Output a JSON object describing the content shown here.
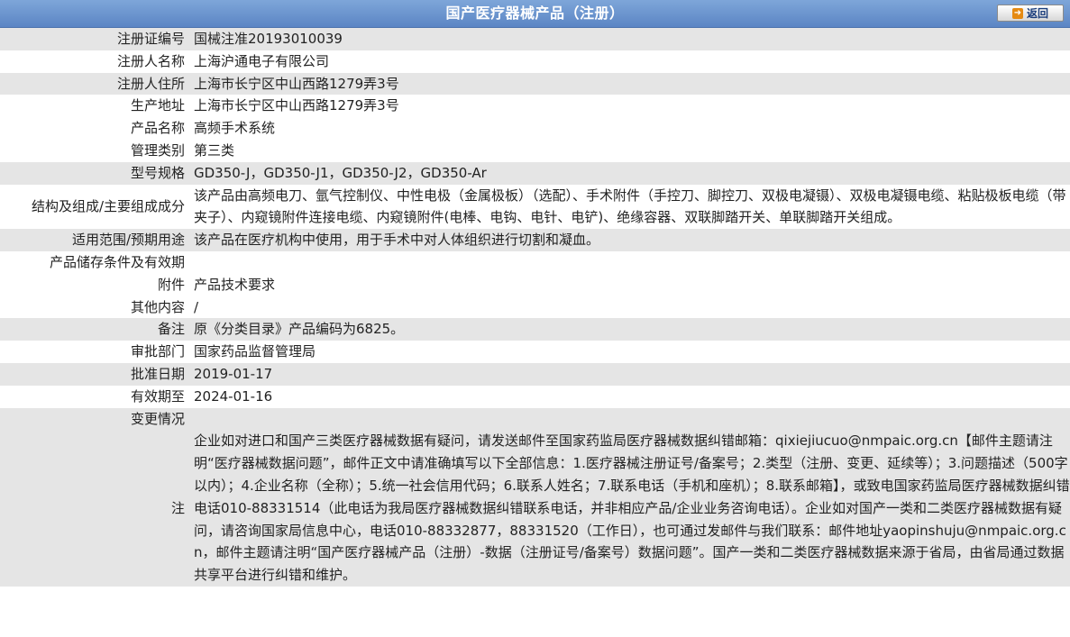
{
  "header": {
    "title": "国产医疗器械产品（注册）",
    "back_label": "返回"
  },
  "rows": [
    {
      "label": "注册证编号",
      "value": "国械注准20193010039"
    },
    {
      "label": "注册人名称",
      "value": "上海沪通电子有限公司"
    },
    {
      "label": "注册人住所",
      "value": "上海市长宁区中山西路1279弄3号"
    },
    {
      "label": "生产地址",
      "value": "上海市长宁区中山西路1279弄3号"
    },
    {
      "label": "产品名称",
      "value": "高频手术系统"
    },
    {
      "label": "管理类别",
      "value": "第三类"
    },
    {
      "label": "型号规格",
      "value": "GD350-J，GD350-J1，GD350-J2，GD350-Ar"
    },
    {
      "label": "结构及组成/主要组成成分",
      "value": "该产品由高频电刀、氩气控制仪、中性电极（金属极板）（选配）、手术附件（手控刀、脚控刀、双极电凝镊）、双极电凝镊电缆、粘贴极板电缆（带夹子）、内窥镜附件连接电缆、内窥镜附件(电棒、电钩、电针、电铲)、绝缘容器、双联脚踏开关、单联脚踏开关组成。"
    },
    {
      "label": "适用范围/预期用途",
      "value": "该产品在医疗机构中使用，用于手术中对人体组织进行切割和凝血。"
    },
    {
      "label": "产品储存条件及有效期",
      "value": ""
    },
    {
      "label": "附件",
      "value": "产品技术要求"
    },
    {
      "label": "其他内容",
      "value": "/"
    },
    {
      "label": "备注",
      "value": "原《分类目录》产品编码为6825。"
    },
    {
      "label": "审批部门",
      "value": "国家药品监督管理局"
    },
    {
      "label": "批准日期",
      "value": "2019-01-17"
    },
    {
      "label": "有效期至",
      "value": "2024-01-16"
    },
    {
      "label": "变更情况",
      "value": ""
    }
  ],
  "note": {
    "label": "注",
    "text": "企业如对进口和国产三类医疗器械数据有疑问，请发送邮件至国家药监局医疗器械数据纠错邮箱：qixiejiucuo@nmpaic.org.cn【邮件主题请注明“医疗器械数据问题”，邮件正文中请准确填写以下全部信息：1.医疗器械注册证号/备案号；2.类型（注册、变更、延续等）；3.问题描述（500字以内）；4.企业名称（全称）；5.统一社会信用代码；6.联系人姓名；7.联系电话（手机和座机）；8.联系邮箱】，或致电国家药监局医疗器械数据纠错电话010-88331514（此电话为我局医疗器械数据纠错联系电话，并非相应产品/企业业务咨询电话）。企业如对国产一类和二类医疗器械数据有疑问，请咨询国家局信息中心，电话010-88332877，88331520（工作日），也可通过发邮件与我们联系：邮件地址yaopinshuju@nmpaic.org.cn，邮件主题请注明“国产医疗器械产品（注册）-数据（注册证号/备案号）数据问题”。国产一类和二类医疗器械数据来源于省局，由省局通过数据共享平台进行纠错和维护。"
  },
  "colors": {
    "header_bg": "#6a93cf",
    "row_shade": "#e5e5e5",
    "row_plain": "#ffffff",
    "back_icon": "#e58a12"
  }
}
